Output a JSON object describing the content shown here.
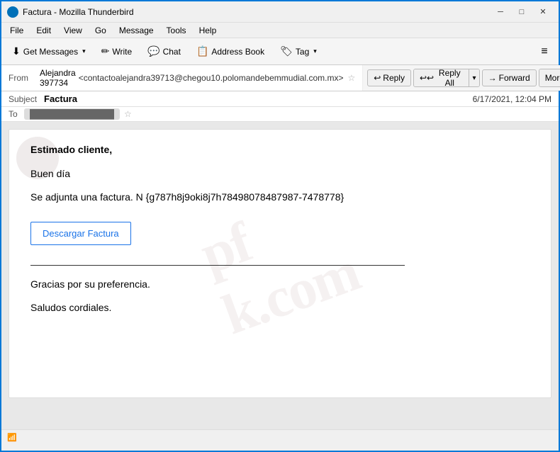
{
  "window": {
    "title": "Factura - Mozilla Thunderbird",
    "icon": "thunderbird"
  },
  "titlebar": {
    "title": "Factura - Mozilla Thunderbird",
    "minimize": "─",
    "maximize": "□",
    "close": "✕"
  },
  "menubar": {
    "items": [
      {
        "label": "File",
        "id": "file"
      },
      {
        "label": "Edit",
        "id": "edit"
      },
      {
        "label": "View",
        "id": "view"
      },
      {
        "label": "Go",
        "id": "go"
      },
      {
        "label": "Message",
        "id": "message"
      },
      {
        "label": "Tools",
        "id": "tools"
      },
      {
        "label": "Help",
        "id": "help"
      }
    ]
  },
  "toolbar": {
    "get_messages_label": "Get Messages",
    "write_label": "Write",
    "chat_label": "Chat",
    "address_book_label": "Address Book",
    "tag_label": "Tag",
    "menu_icon": "≡"
  },
  "action_buttons": {
    "reply_label": "Reply",
    "reply_all_label": "Reply All",
    "forward_label": "Forward",
    "more_label": "More"
  },
  "email": {
    "from_label": "From",
    "from_name": "Alejandra 397734",
    "from_email": "<contactoalejandra39713@chegou10.polomandebemmudial.com.mx>",
    "subject_label": "Subject",
    "subject": "Factura",
    "date": "6/17/2021, 12:04 PM",
    "to_label": "To",
    "to_value": "██████████████",
    "body": {
      "greeting": "Estimado cliente,",
      "line1": "Buen día",
      "line2": "Se adjunta una factura. N {g787h8j9oki8j7h78498078487987-7478778}",
      "download_btn": "Descargar Factura",
      "line3": "Gracias por su preferencia.",
      "line4": "Saludos cordiales."
    }
  },
  "statusbar": {
    "icon": "📶",
    "text": ""
  },
  "colors": {
    "accent": "#0078d7",
    "link": "#1a73e8"
  }
}
